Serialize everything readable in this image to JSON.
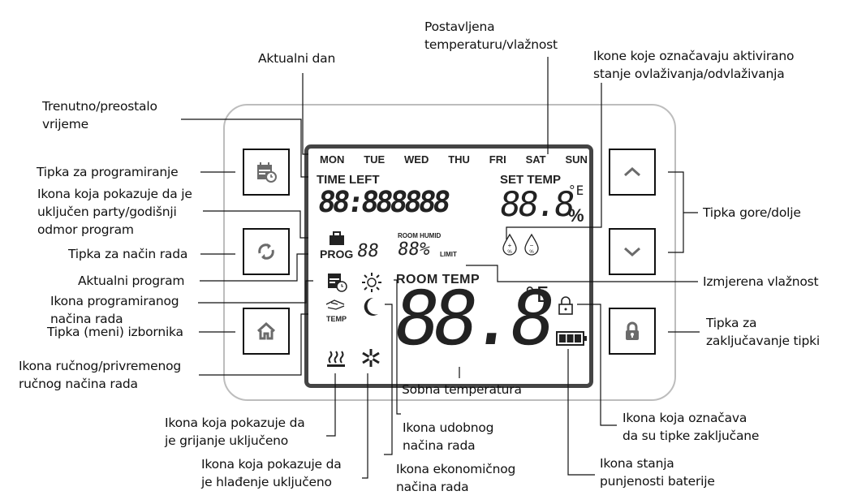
{
  "labels": {
    "current_day": "Aktualni dan",
    "set_temp": "Postavljena\ntemperaturu/vlažnost",
    "humid_icons": "Ikone koje označavaju aktivirano\nstanje ovlaživanja/odvlaživanja",
    "time_left": "Trenutno/preostalo\nvrijeme",
    "prog_button": "Tipka za programiranje",
    "party_icon": "Ikona koja pokazuje da je\nuključen party/godišnji\nodmor program",
    "mode_button": "Tipka za način rada",
    "current_program": "Aktualni program",
    "programmed_mode_icon": "Ikona programiranog\nnačina rada",
    "menu_button": "Tipka (meni) izbornika",
    "manual_icon": "Ikona ručnog/privremenog\nručnog načina rada",
    "up_down_button": "Tipka gore/dolje",
    "measured_humidity": "Izmjerena vlažnost",
    "lock_button": "Tipka za\nzaključavanje tipki",
    "room_temp": "Sobna temperatura",
    "heating_icon": "Ikona koja pokazuje da\nje grijanje uključeno",
    "comfort_icon": "Ikona udobnog\nnačina rada",
    "cooling_icon": "Ikona koja pokazuje da\nje hlađenje uključeno",
    "eco_icon": "Ikona ekonomičnog\nnačina rada",
    "locked_icon": "Ikona koja označava\nda su tipke zaključane",
    "battery_icon": "Ikona stanja\npunjenosti baterije"
  },
  "lcd": {
    "days": [
      "MON",
      "TUE",
      "WED",
      "THU",
      "FRI",
      "SAT",
      "SUN"
    ],
    "time_left": "TIME LEFT",
    "time_digits": "88:888888",
    "set_temp": "SET TEMP",
    "set_value": "88.8",
    "unit_deg": "°E",
    "percent": "%",
    "prog": "PROG",
    "prog_digits": "88",
    "room_humid": "ROOM HUMID",
    "humid_value": "88%",
    "limit": "LIMIT",
    "room_temp": "ROOM TEMP",
    "room_value": "88.8",
    "temp_small": "TEMP"
  },
  "colors": {
    "lcd_border": "#444444",
    "device_border": "#bdbdbd",
    "icon_gray": "#6b6b6b"
  }
}
